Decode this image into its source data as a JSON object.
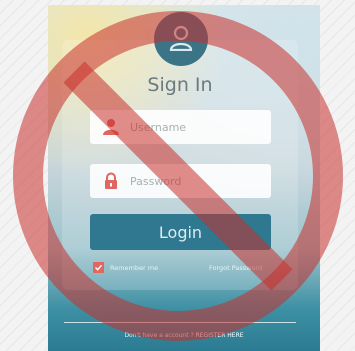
{
  "header": {
    "title": "Sign In"
  },
  "form": {
    "username_placeholder": "Username",
    "password_placeholder": "Password",
    "login_label": "Login",
    "remember_label": "Remember me",
    "forgot_label": "Forgot Password"
  },
  "footer": {
    "prompt": "Don't have a account ?",
    "register_label": "REGISTER HERE"
  },
  "icons": {
    "avatar": "user-icon",
    "username": "user-icon",
    "password": "lock-icon",
    "checkbox": "check-icon",
    "overlay": "prohibition-icon"
  },
  "colors": {
    "accent": "#2f7890",
    "icon_red": "#e0665f",
    "overlay_red": "#c9302c",
    "avatar_bg": "#3c7487"
  }
}
